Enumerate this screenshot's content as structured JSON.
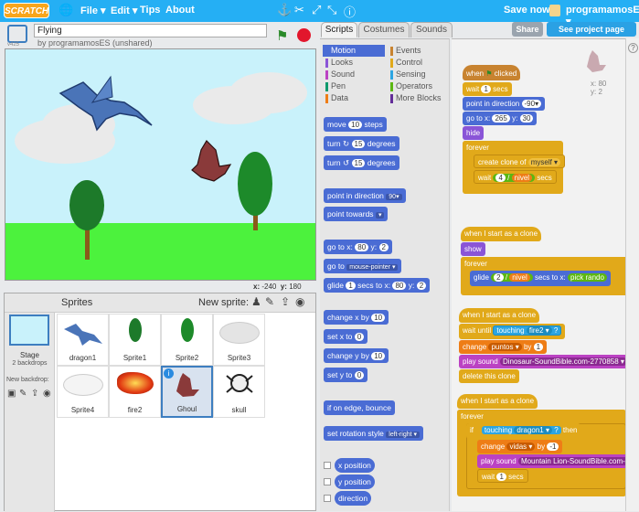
{
  "topbar": {
    "logo": "SCRATCH",
    "menu_file": "File ▾",
    "menu_edit": "Edit ▾",
    "menu_tips": "Tips",
    "menu_about": "About",
    "save_now": "Save now",
    "user": "programamosES ▾"
  },
  "project": {
    "title": "Flying",
    "by": "by programamosES (unshared)",
    "version": "v425",
    "share": "Share",
    "see_page": "See project page"
  },
  "stage": {
    "x_label": "x:",
    "x_value": "-240",
    "y_label": "y:",
    "y_value": "180"
  },
  "sprites_panel": {
    "title": "Sprites",
    "new_sprite": "New sprite:",
    "stage_label": "Stage",
    "backdrops": "2 backdrops",
    "new_backdrop": "New backdrop:",
    "sprites": [
      "dragon1",
      "Sprite1",
      "Sprite2",
      "Sprite3",
      "Sprite4",
      "fire2",
      "Ghoul",
      "skull"
    ]
  },
  "tabs": {
    "scripts": "Scripts",
    "costumes": "Costumes",
    "sounds": "Sounds"
  },
  "categories": {
    "left": [
      {
        "label": "Motion",
        "color": "#4a6cd4"
      },
      {
        "label": "Looks",
        "color": "#8a55d7"
      },
      {
        "label": "Sound",
        "color": "#bb42c3"
      },
      {
        "label": "Pen",
        "color": "#0e9a6c"
      },
      {
        "label": "Data",
        "color": "#ee7d16"
      }
    ],
    "right": [
      {
        "label": "Events",
        "color": "#c88330"
      },
      {
        "label": "Control",
        "color": "#e1a91a"
      },
      {
        "label": "Sensing",
        "color": "#2ca5e2"
      },
      {
        "label": "Operators",
        "color": "#5cb712"
      },
      {
        "label": "More Blocks",
        "color": "#632d99"
      }
    ]
  },
  "palette": {
    "move": "move",
    "move_n": "10",
    "steps": "steps",
    "turn_r": "turn",
    "turn_r_n": "15",
    "degrees": "degrees",
    "turn_l": "turn",
    "turn_l_n": "15",
    "point_dir": "point in direction",
    "point_dir_v": "90▾",
    "point_towards": "point towards",
    "point_towards_v": "▾",
    "goto_xy": "go to x:",
    "goto_x": "80",
    "y": "y:",
    "goto_y": "2",
    "goto": "go to",
    "goto_v": "mouse-pointer ▾",
    "glide": "glide",
    "glide_s": "1",
    "secs_to_x": "secs to x:",
    "glide_x": "80",
    "glide_y": "2",
    "change_x": "change x by",
    "change_x_v": "10",
    "set_x": "set x to",
    "set_x_v": "0",
    "change_y": "change y by",
    "change_y_v": "10",
    "set_y": "set y to",
    "set_y_v": "0",
    "bounce": "if on edge, bounce",
    "rot_style": "set rotation style",
    "rot_style_v": "left-right ▾",
    "x_position": "x position",
    "y_position": "y position",
    "direction": "direction"
  },
  "scripts": {
    "sprite_x": "x: 80",
    "sprite_y": "y: 2",
    "s1_hat": "when",
    "s1_clicked": "clicked",
    "s1_wait": "wait",
    "s1_wait_v": "1",
    "secs": "secs",
    "s1_point": "point in direction",
    "s1_point_v": "-90▾",
    "s1_goto": "go to x:",
    "s1_goto_x": "265",
    "y": "y:",
    "s1_goto_y": "30",
    "s1_hide": "hide",
    "forever": "forever",
    "s1_clone": "create clone of",
    "s1_clone_v": "myself ▾",
    "s1_wait2": "wait",
    "s1_wait2_a": "4",
    "slash": "/",
    "nivel": "nivel",
    "s2_hat": "when I start as a clone",
    "s2_show": "show",
    "s2_glide": "glide",
    "s2_glide_a": "2",
    "s2_secs": "secs to x:",
    "s2_pick": "pick rando",
    "s3_hat": "when I start as a clone",
    "s3_wait_until": "wait until",
    "s3_touching": "touching",
    "s3_touching_v": "fire2 ▾",
    "q": "?",
    "s3_change": "change",
    "s3_change_v": "puntos ▾",
    "by": "by",
    "s3_change_n": "1",
    "s3_play": "play sound",
    "s3_play_v": "Dinosaur-SoundBible.com-2770858 ▾",
    "s3_delete": "delete this clone",
    "s4_hat": "when I start as a clone",
    "s4_if": "if",
    "s4_touching": "touching",
    "s4_touching_v": "dragon1 ▾",
    "then": "then",
    "s4_change": "change",
    "s4_change_v": "vidas ▾",
    "s4_change_n": "-1",
    "s4_play": "play sound",
    "s4_play_v": "Mountain Lion-SoundBible.com-68",
    "s4_wait": "wait",
    "s4_wait_v": "1"
  }
}
